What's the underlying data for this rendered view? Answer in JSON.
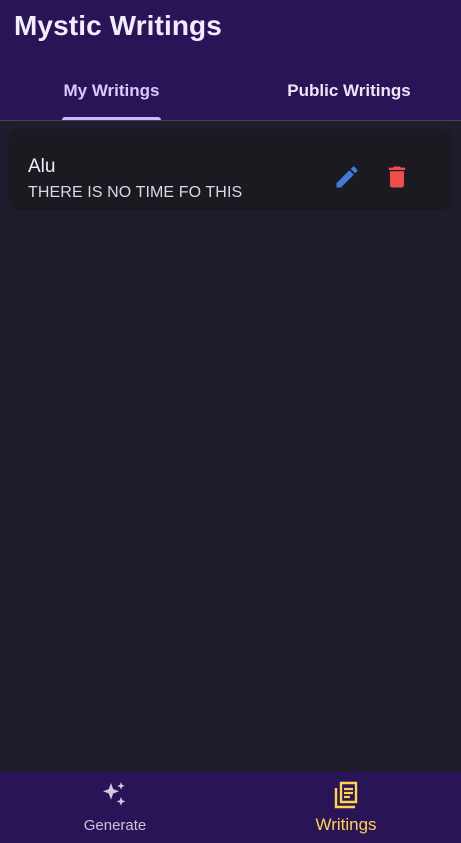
{
  "app": {
    "title": "Mystic Writings"
  },
  "tabs": [
    {
      "label": "My Writings",
      "selected": true
    },
    {
      "label": "Public Writings",
      "selected": false
    }
  ],
  "writings": [
    {
      "title": "Alu",
      "text": "THERE IS NO TIME FO THIS",
      "actions": [
        {
          "icon": "edit-icon",
          "color": "#3f7dd9"
        },
        {
          "icon": "delete-icon",
          "color": "#f14b4b"
        }
      ]
    }
  ],
  "fab": {
    "icon": "plus-icon",
    "color": "#4d3291"
  },
  "bottom_nav": {
    "items": [
      {
        "label": "Generate",
        "icon": "sparkles-icon",
        "selected": false,
        "color": "#c9c4d6"
      },
      {
        "label": "Writings",
        "icon": "library-books-icon",
        "selected": true,
        "color": "#ffd34a"
      }
    ]
  },
  "colors": {
    "app_bar": "#2a1458",
    "background": "#1f1d2c",
    "card": "#1c1a21",
    "tab_indicator": "#cbb8ff"
  }
}
